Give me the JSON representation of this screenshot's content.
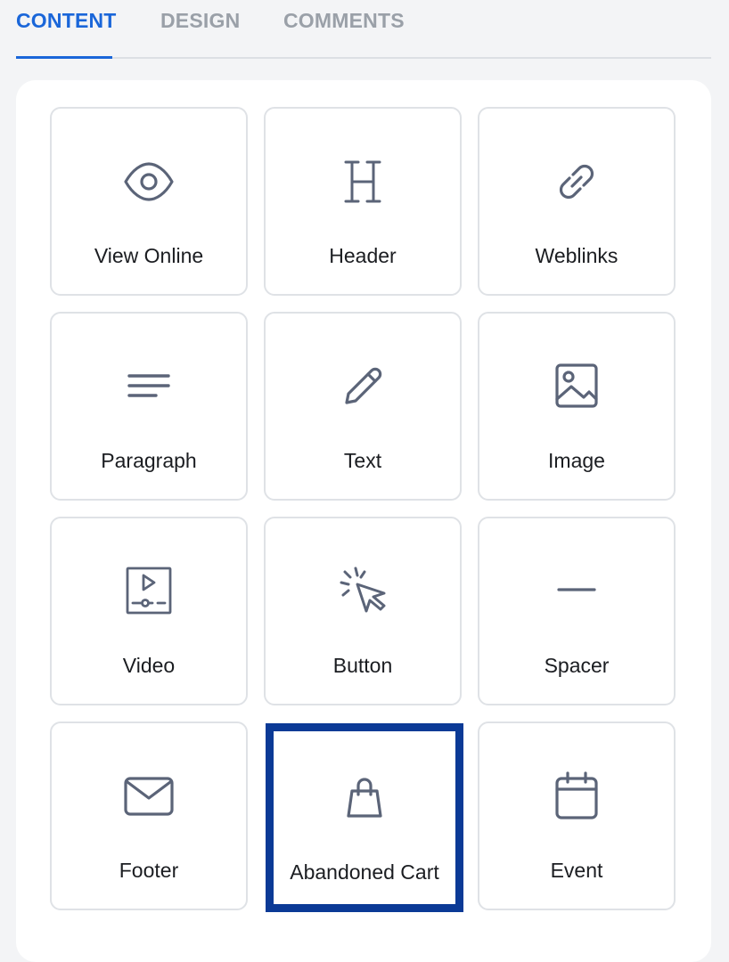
{
  "tabs": [
    {
      "label": "CONTENT",
      "active": true
    },
    {
      "label": "DESIGN",
      "active": false
    },
    {
      "label": "COMMENTS",
      "active": false
    }
  ],
  "colors": {
    "accent": "#1a66d9",
    "selected_border": "#0b3a96",
    "icon": "#5b6478"
  },
  "blocks": [
    {
      "label": "View Online",
      "icon": "eye-icon"
    },
    {
      "label": "Header",
      "icon": "heading-icon"
    },
    {
      "label": "Weblinks",
      "icon": "link-icon"
    },
    {
      "label": "Paragraph",
      "icon": "paragraph-icon"
    },
    {
      "label": "Text",
      "icon": "pencil-icon"
    },
    {
      "label": "Image",
      "icon": "image-icon"
    },
    {
      "label": "Video",
      "icon": "video-icon"
    },
    {
      "label": "Button",
      "icon": "cursor-click-icon"
    },
    {
      "label": "Spacer",
      "icon": "spacer-icon"
    },
    {
      "label": "Footer",
      "icon": "envelope-icon"
    },
    {
      "label": "Abandoned Cart",
      "icon": "shopping-bag-icon",
      "selected": true
    },
    {
      "label": "Event",
      "icon": "calendar-icon"
    }
  ]
}
